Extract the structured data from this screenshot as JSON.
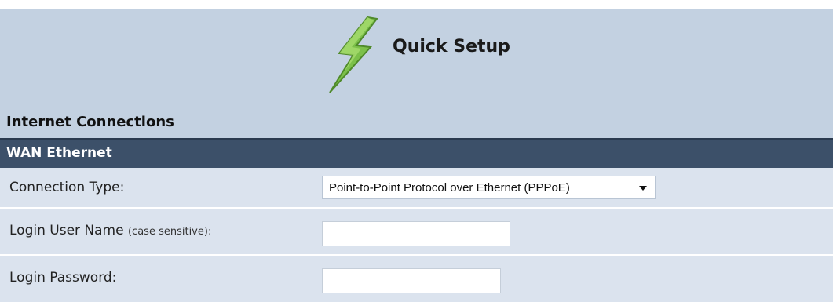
{
  "header": {
    "title": "Quick Setup"
  },
  "section": {
    "title": "Internet Connections"
  },
  "band": {
    "label": "WAN Ethernet"
  },
  "form": {
    "connection_type": {
      "label": "Connection Type:",
      "value": "Point-to-Point Protocol over Ethernet (PPPoE)"
    },
    "login_user": {
      "label": "Login User Name",
      "note": "(case sensitive):",
      "value": ""
    },
    "login_password": {
      "label": "Login Password:",
      "value": ""
    }
  },
  "icons": {
    "header_icon": "lightning-bolt-icon",
    "dropdown": "chevron-down-icon"
  },
  "colors": {
    "header_bg": "#c3d1e1",
    "band_bg": "#3c5069",
    "row_bg": "#dbe3ee",
    "bolt": "#7cc04a"
  }
}
